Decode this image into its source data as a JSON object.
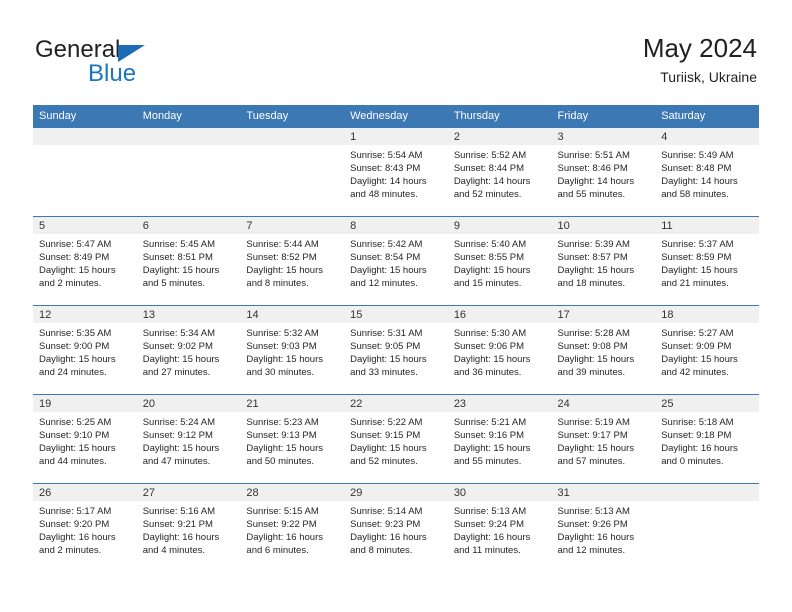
{
  "brand": {
    "name_part1": "General",
    "name_part2": "Blue",
    "logo_icon": "blue-triangle-icon"
  },
  "header": {
    "title": "May 2024",
    "location": "Turiisk, Ukraine"
  },
  "colors": {
    "header_blue": "#3c78b4",
    "brand_blue": "#1b75bc",
    "daynum_bg": "#f0f0f0",
    "text": "#262626"
  },
  "weekday_headers": [
    "Sunday",
    "Monday",
    "Tuesday",
    "Wednesday",
    "Thursday",
    "Friday",
    "Saturday"
  ],
  "weeks": [
    [
      {
        "day": "",
        "sunrise": "",
        "sunset": "",
        "daylight": ""
      },
      {
        "day": "",
        "sunrise": "",
        "sunset": "",
        "daylight": ""
      },
      {
        "day": "",
        "sunrise": "",
        "sunset": "",
        "daylight": ""
      },
      {
        "day": "1",
        "sunrise": "Sunrise: 5:54 AM",
        "sunset": "Sunset: 8:43 PM",
        "daylight": "Daylight: 14 hours and 48 minutes."
      },
      {
        "day": "2",
        "sunrise": "Sunrise: 5:52 AM",
        "sunset": "Sunset: 8:44 PM",
        "daylight": "Daylight: 14 hours and 52 minutes."
      },
      {
        "day": "3",
        "sunrise": "Sunrise: 5:51 AM",
        "sunset": "Sunset: 8:46 PM",
        "daylight": "Daylight: 14 hours and 55 minutes."
      },
      {
        "day": "4",
        "sunrise": "Sunrise: 5:49 AM",
        "sunset": "Sunset: 8:48 PM",
        "daylight": "Daylight: 14 hours and 58 minutes."
      }
    ],
    [
      {
        "day": "5",
        "sunrise": "Sunrise: 5:47 AM",
        "sunset": "Sunset: 8:49 PM",
        "daylight": "Daylight: 15 hours and 2 minutes."
      },
      {
        "day": "6",
        "sunrise": "Sunrise: 5:45 AM",
        "sunset": "Sunset: 8:51 PM",
        "daylight": "Daylight: 15 hours and 5 minutes."
      },
      {
        "day": "7",
        "sunrise": "Sunrise: 5:44 AM",
        "sunset": "Sunset: 8:52 PM",
        "daylight": "Daylight: 15 hours and 8 minutes."
      },
      {
        "day": "8",
        "sunrise": "Sunrise: 5:42 AM",
        "sunset": "Sunset: 8:54 PM",
        "daylight": "Daylight: 15 hours and 12 minutes."
      },
      {
        "day": "9",
        "sunrise": "Sunrise: 5:40 AM",
        "sunset": "Sunset: 8:55 PM",
        "daylight": "Daylight: 15 hours and 15 minutes."
      },
      {
        "day": "10",
        "sunrise": "Sunrise: 5:39 AM",
        "sunset": "Sunset: 8:57 PM",
        "daylight": "Daylight: 15 hours and 18 minutes."
      },
      {
        "day": "11",
        "sunrise": "Sunrise: 5:37 AM",
        "sunset": "Sunset: 8:59 PM",
        "daylight": "Daylight: 15 hours and 21 minutes."
      }
    ],
    [
      {
        "day": "12",
        "sunrise": "Sunrise: 5:35 AM",
        "sunset": "Sunset: 9:00 PM",
        "daylight": "Daylight: 15 hours and 24 minutes."
      },
      {
        "day": "13",
        "sunrise": "Sunrise: 5:34 AM",
        "sunset": "Sunset: 9:02 PM",
        "daylight": "Daylight: 15 hours and 27 minutes."
      },
      {
        "day": "14",
        "sunrise": "Sunrise: 5:32 AM",
        "sunset": "Sunset: 9:03 PM",
        "daylight": "Daylight: 15 hours and 30 minutes."
      },
      {
        "day": "15",
        "sunrise": "Sunrise: 5:31 AM",
        "sunset": "Sunset: 9:05 PM",
        "daylight": "Daylight: 15 hours and 33 minutes."
      },
      {
        "day": "16",
        "sunrise": "Sunrise: 5:30 AM",
        "sunset": "Sunset: 9:06 PM",
        "daylight": "Daylight: 15 hours and 36 minutes."
      },
      {
        "day": "17",
        "sunrise": "Sunrise: 5:28 AM",
        "sunset": "Sunset: 9:08 PM",
        "daylight": "Daylight: 15 hours and 39 minutes."
      },
      {
        "day": "18",
        "sunrise": "Sunrise: 5:27 AM",
        "sunset": "Sunset: 9:09 PM",
        "daylight": "Daylight: 15 hours and 42 minutes."
      }
    ],
    [
      {
        "day": "19",
        "sunrise": "Sunrise: 5:25 AM",
        "sunset": "Sunset: 9:10 PM",
        "daylight": "Daylight: 15 hours and 44 minutes."
      },
      {
        "day": "20",
        "sunrise": "Sunrise: 5:24 AM",
        "sunset": "Sunset: 9:12 PM",
        "daylight": "Daylight: 15 hours and 47 minutes."
      },
      {
        "day": "21",
        "sunrise": "Sunrise: 5:23 AM",
        "sunset": "Sunset: 9:13 PM",
        "daylight": "Daylight: 15 hours and 50 minutes."
      },
      {
        "day": "22",
        "sunrise": "Sunrise: 5:22 AM",
        "sunset": "Sunset: 9:15 PM",
        "daylight": "Daylight: 15 hours and 52 minutes."
      },
      {
        "day": "23",
        "sunrise": "Sunrise: 5:21 AM",
        "sunset": "Sunset: 9:16 PM",
        "daylight": "Daylight: 15 hours and 55 minutes."
      },
      {
        "day": "24",
        "sunrise": "Sunrise: 5:19 AM",
        "sunset": "Sunset: 9:17 PM",
        "daylight": "Daylight: 15 hours and 57 minutes."
      },
      {
        "day": "25",
        "sunrise": "Sunrise: 5:18 AM",
        "sunset": "Sunset: 9:18 PM",
        "daylight": "Daylight: 16 hours and 0 minutes."
      }
    ],
    [
      {
        "day": "26",
        "sunrise": "Sunrise: 5:17 AM",
        "sunset": "Sunset: 9:20 PM",
        "daylight": "Daylight: 16 hours and 2 minutes."
      },
      {
        "day": "27",
        "sunrise": "Sunrise: 5:16 AM",
        "sunset": "Sunset: 9:21 PM",
        "daylight": "Daylight: 16 hours and 4 minutes."
      },
      {
        "day": "28",
        "sunrise": "Sunrise: 5:15 AM",
        "sunset": "Sunset: 9:22 PM",
        "daylight": "Daylight: 16 hours and 6 minutes."
      },
      {
        "day": "29",
        "sunrise": "Sunrise: 5:14 AM",
        "sunset": "Sunset: 9:23 PM",
        "daylight": "Daylight: 16 hours and 8 minutes."
      },
      {
        "day": "30",
        "sunrise": "Sunrise: 5:13 AM",
        "sunset": "Sunset: 9:24 PM",
        "daylight": "Daylight: 16 hours and 11 minutes."
      },
      {
        "day": "31",
        "sunrise": "Sunrise: 5:13 AM",
        "sunset": "Sunset: 9:26 PM",
        "daylight": "Daylight: 16 hours and 12 minutes."
      },
      {
        "day": "",
        "sunrise": "",
        "sunset": "",
        "daylight": ""
      }
    ]
  ]
}
